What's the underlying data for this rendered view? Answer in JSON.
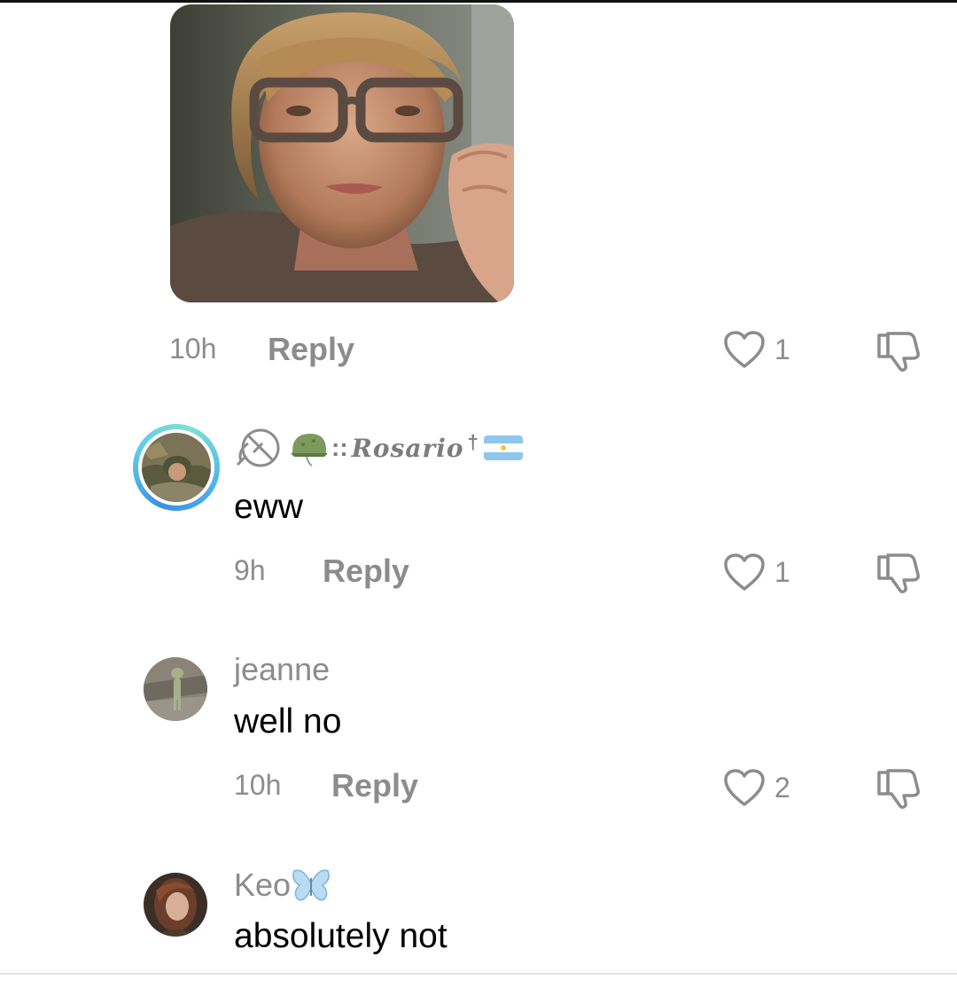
{
  "comments": [
    {
      "time": "10h",
      "reply_label": "Reply",
      "likes": "1"
    },
    {
      "username_prefix": "::",
      "username_script": "Rosario",
      "username_cross": "†",
      "text": "eww",
      "time": "9h",
      "reply_label": "Reply",
      "likes": "1",
      "avatar_ring_colors": [
        "#3b8fe6",
        "#7fe0d5"
      ]
    },
    {
      "username": "jeanne",
      "text": "well no",
      "time": "10h",
      "reply_label": "Reply",
      "likes": "2"
    },
    {
      "username": "Keo",
      "text": "absolutely not"
    }
  ],
  "icons": {
    "like": "heart-outline-icon",
    "dislike": "thumbs-down-icon",
    "emoji_helmet": "military-helmet-emoji",
    "emoji_flag": "argentina-flag-emoji",
    "emoji_butterfly": "butterfly-emoji",
    "emoji_no_symbol": "prohibited-hammer-sickle-icon"
  },
  "colors": {
    "secondary_text": "#8c8c8c",
    "primary_text": "#000000"
  }
}
